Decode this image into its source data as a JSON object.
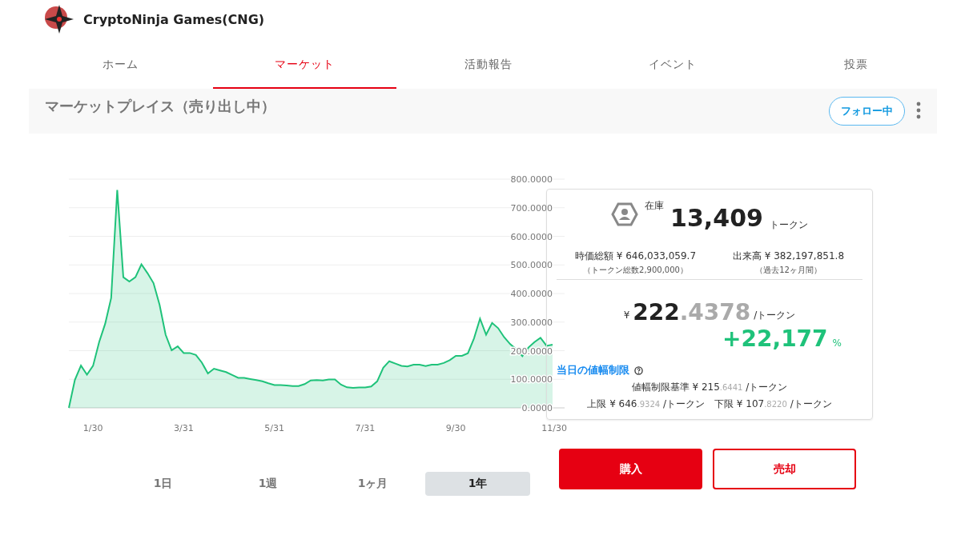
{
  "header": {
    "brand": "CryptoNinja Games(CNG)"
  },
  "tabs": [
    {
      "label": "ホーム",
      "selected": false
    },
    {
      "label": "マーケット",
      "selected": true
    },
    {
      "label": "活動報告",
      "selected": false
    },
    {
      "label": "イベント",
      "selected": false
    },
    {
      "label": "投票",
      "selected": false
    }
  ],
  "section": {
    "title": "マーケットプレイス（売り出し中）",
    "follow_button": "フォロー中"
  },
  "chart_data": {
    "type": "area",
    "grid": true,
    "ylim": [
      0,
      800
    ],
    "categories": [
      null,
      null,
      null,
      null,
      "1/30",
      null,
      null,
      null,
      null,
      null,
      null,
      null,
      null,
      null,
      null,
      null,
      null,
      null,
      null,
      "3/31",
      null,
      null,
      null,
      null,
      null,
      null,
      null,
      null,
      null,
      null,
      null,
      null,
      null,
      null,
      "5/31",
      null,
      null,
      null,
      null,
      null,
      null,
      null,
      null,
      null,
      null,
      null,
      null,
      null,
      null,
      "7/31",
      null,
      null,
      null,
      null,
      null,
      null,
      null,
      null,
      null,
      null,
      null,
      null,
      null,
      null,
      "9/30",
      null,
      null,
      null,
      null,
      null,
      null,
      null,
      null,
      null,
      null,
      null,
      null,
      null,
      null,
      null,
      "11/30"
    ],
    "yticks": [
      {
        "value": 0,
        "label": "0.0000"
      },
      {
        "value": 100,
        "label": "100.0000"
      },
      {
        "value": 200,
        "label": "200.0000"
      },
      {
        "value": 300,
        "label": "300.0000"
      },
      {
        "value": 400,
        "label": "400.0000"
      },
      {
        "value": 500,
        "label": "500.0000"
      },
      {
        "value": 600,
        "label": "600.0000"
      },
      {
        "value": 700,
        "label": "700.0000"
      },
      {
        "value": 800,
        "label": "800.0000"
      }
    ],
    "series": [
      {
        "color": "#1fc27a",
        "values": [
          0,
          98,
          148,
          116,
          147,
          230,
          294,
          384,
          762,
          457,
          442,
          457,
          502,
          471,
          436,
          360,
          256,
          201,
          215,
          192,
          192,
          185,
          158,
          120,
          137,
          131,
          125,
          115,
          105,
          105,
          101,
          97,
          93,
          86,
          80,
          80,
          78,
          76,
          76,
          83,
          96,
          97,
          96,
          99,
          99,
          81,
          72,
          70,
          71,
          71,
          75,
          93,
          140,
          163,
          155,
          147,
          145,
          151,
          151,
          146,
          151,
          151,
          157,
          167,
          182,
          182,
          191,
          243,
          312,
          256,
          297,
          279,
          247,
          223,
          205,
          181,
          211,
          230,
          245,
          217,
          221
        ]
      }
    ]
  },
  "ranges": [
    {
      "label": "1日",
      "selected": false
    },
    {
      "label": "1週",
      "selected": false
    },
    {
      "label": "1ヶ月",
      "selected": false
    },
    {
      "label": "1年",
      "selected": true
    }
  ],
  "stock": {
    "label": "在庫",
    "value": "13,409",
    "unit": "トークン"
  },
  "market_cap": {
    "label": "時価総額 ¥ 646,033,059.7",
    "note": "（トークン総数2,900,000）"
  },
  "volume": {
    "label": "出来高 ¥ 382,197,851.8",
    "note": "（過去12ヶ月間）"
  },
  "price": {
    "currency": "¥",
    "integer": "222",
    "decimal": ".4378",
    "unit": "/トークン"
  },
  "change": {
    "value": "+22,177",
    "unit": "%"
  },
  "limits": {
    "title": "当日の値幅制限",
    "rows": [
      [
        {
          "label": "値幅制限基準 ¥ 215",
          "decimal": ".6441",
          "unit": "/トークン"
        }
      ],
      [
        {
          "label": "上限 ¥ 646",
          "decimal": ".9324",
          "unit": "/トークン"
        },
        {
          "label": "下限 ¥ 107",
          "decimal": ".8220",
          "unit": "/トークン"
        }
      ]
    ]
  },
  "actions": [
    {
      "label": "購入",
      "kind": "primary"
    },
    {
      "label": "売却",
      "kind": "outline"
    }
  ]
}
